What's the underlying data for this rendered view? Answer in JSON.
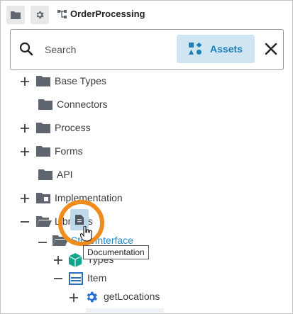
{
  "header": {
    "breadcrumb": "OrderProcessing"
  },
  "search": {
    "placeholder": "Search",
    "assets_label": "Assets"
  },
  "tree": {
    "base_types": "Base Types",
    "connectors": "Connectors",
    "process": "Process",
    "forms": "Forms",
    "api": "API",
    "implementation": "Implementation",
    "libraries": "Libraries",
    "store_interface": "StoreInterface",
    "types": "Types",
    "item": "Item",
    "get_locations": "getLocations"
  },
  "tooltip": "Documentation",
  "colors": {
    "folder": "#5f6670",
    "accent": "#1f86c8",
    "assets_bg": "#cfe5f2",
    "highlight_ring": "#f08c1e",
    "types_icon": "#13a38f",
    "item_icon": "#2a6fba",
    "method_icon": "#2a6fd6"
  },
  "icons": [
    "folder-icon",
    "gear-icon",
    "flow-icon",
    "search-icon",
    "assets-icon",
    "close-icon",
    "document-icon",
    "hand-cursor-icon"
  ]
}
